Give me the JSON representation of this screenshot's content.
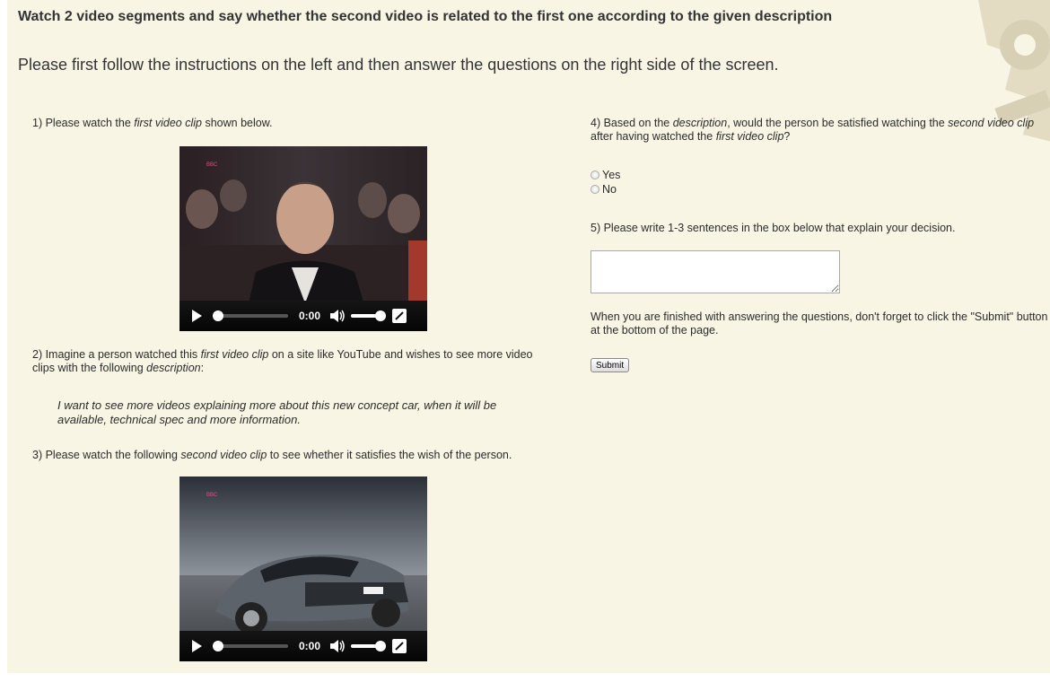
{
  "header": {
    "title": "Watch 2 video segments and say whether the second video is related to the first one according to the given description",
    "subtitle": "Please first follow the instructions on the left and then answer the questions on the right side of the screen."
  },
  "left": {
    "q1": {
      "before": "1) Please watch the ",
      "em": "first video clip",
      "after": " shown below."
    },
    "video1": {
      "time": "0:00"
    },
    "q2": {
      "before": "2) Imagine a person watched this ",
      "em1": "first video clip",
      "middle": " on a site like YouTube and wishes to see more video clips with the following ",
      "em2": "description",
      "after": ":"
    },
    "description": "I want to see more videos explaining more about this new concept car, when it will be available, technical spec and more information.",
    "q3": {
      "before": "3) Please watch the following ",
      "em": "second video clip",
      "after": " to see whether it satisfies the wish of the person."
    },
    "video2": {
      "time": "0:00"
    }
  },
  "right": {
    "q4": {
      "before": "4) Based on the ",
      "em1": "description",
      "middle": ", would the person be satisfied watching the ",
      "em2": "second video clip",
      "middle2": " after having watched the ",
      "em3": "first video clip",
      "after": "?"
    },
    "options": [
      "Yes",
      "No"
    ],
    "q5": "5) Please write 1-3 sentences in the box below that explain your decision.",
    "explanation_value": "",
    "finish_note": "When you are finished with answering the questions, don't forget to click the \"Submit\" button at the bottom of the page.",
    "submit_label": "Submit"
  }
}
